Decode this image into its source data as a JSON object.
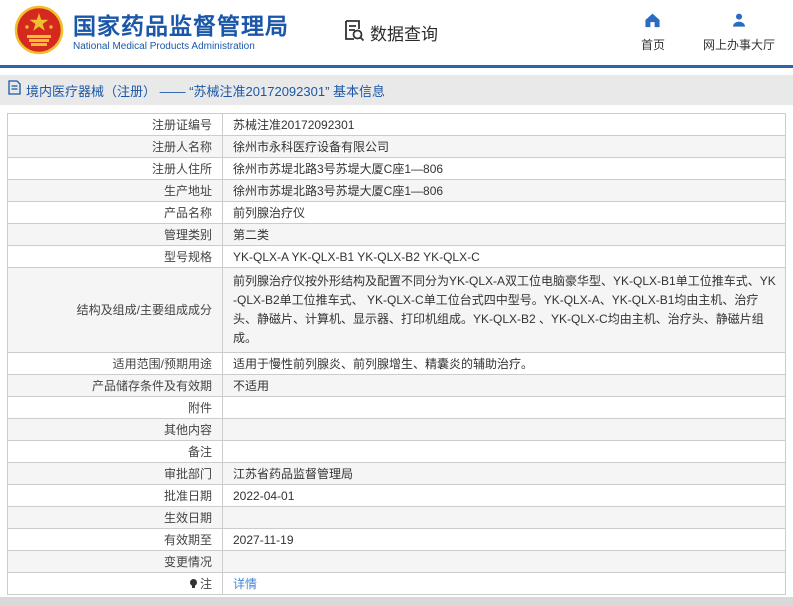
{
  "header": {
    "org": {
      "title": "国家药品监督管理局",
      "subtitle": "National Medical Products Administration"
    },
    "section": {
      "label": "数据查询"
    },
    "nav": [
      {
        "label": "首页",
        "icon": "home-icon"
      },
      {
        "label": "网上办事大厅",
        "icon": "person-icon"
      }
    ]
  },
  "breadcrumb": {
    "text": "境内医疗器械（注册） —— “苏械注准20172092301” 基本信息"
  },
  "table": {
    "rows": [
      {
        "label": "注册证编号",
        "value": "苏械注准20172092301"
      },
      {
        "label": "注册人名称",
        "value": "徐州市永科医疗设备有限公司"
      },
      {
        "label": "注册人住所",
        "value": "徐州市苏堤北路3号苏堤大厦C座1—806"
      },
      {
        "label": "生产地址",
        "value": "徐州市苏堤北路3号苏堤大厦C座1—806"
      },
      {
        "label": "产品名称",
        "value": "前列腺治疗仪"
      },
      {
        "label": "管理类别",
        "value": "第二类"
      },
      {
        "label": "型号规格",
        "value": "YK-QLX-A YK-QLX-B1 YK-QLX-B2 YK-QLX-C"
      },
      {
        "label": "结构及组成/主要组成成分",
        "value": "前列腺治疗仪按外形结构及配置不同分为YK-QLX-A双工位电脑豪华型、YK-QLX-B1单工位推车式、YK-QLX-B2单工位推车式、 YK-QLX-C单工位台式四中型号。YK-QLX-A、YK-QLX-B1均由主机、治疗头、静磁片、计算机、显示器、打印机组成。YK-QLX-B2 、YK-QLX-C均由主机、治疗头、静磁片组成。",
        "tall": true
      },
      {
        "label": "适用范围/预期用途",
        "value": "适用于慢性前列腺炎、前列腺增生、精囊炎的辅助治疗。"
      },
      {
        "label": "产品储存条件及有效期",
        "value": "不适用"
      },
      {
        "label": "附件",
        "value": ""
      },
      {
        "label": "其他内容",
        "value": ""
      },
      {
        "label": "备注",
        "value": ""
      },
      {
        "label": "审批部门",
        "value": "江苏省药品监督管理局"
      },
      {
        "label": "批准日期",
        "value": "2022-04-01"
      },
      {
        "label": "生效日期",
        "value": ""
      },
      {
        "label": "有效期至",
        "value": "2027-11-19"
      },
      {
        "label": "变更情况",
        "value": ""
      },
      {
        "label": "注",
        "value": "详情",
        "icon": "note-bulb-icon",
        "link": true
      }
    ]
  },
  "colors": {
    "brand_blue": "#1b57a8",
    "header_rule_blue": "#2d64a7",
    "nav_icon_blue": "#2a6bc4",
    "link_blue": "#4285d3",
    "stripe_gray": "#f5f5f5",
    "border_gray": "#cccccc",
    "breadcrumb_bg": "#e9e9e9",
    "emblem_red": "#d5281e",
    "emblem_gold": "#f0c02e"
  }
}
